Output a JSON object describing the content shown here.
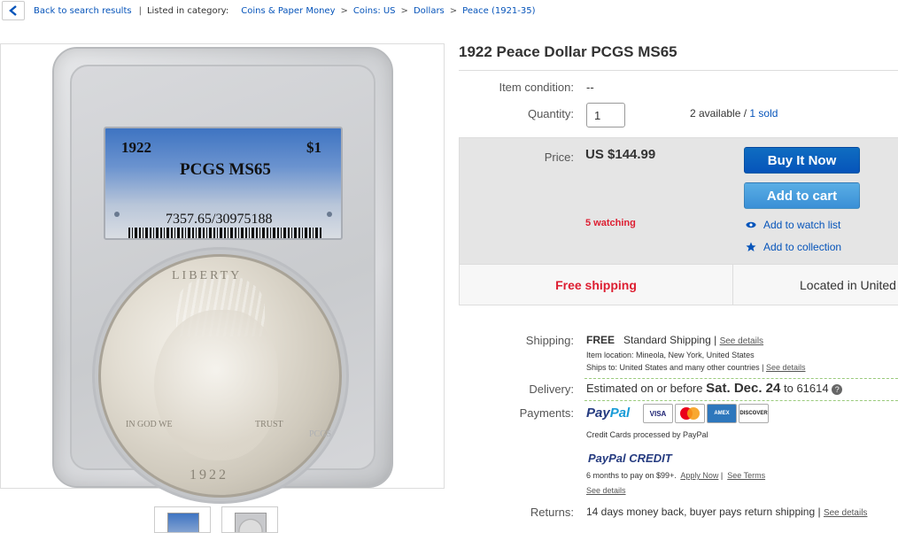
{
  "breadcrumb": {
    "back_label": "Back to search results",
    "separator": "|",
    "listed_label": "Listed in category:",
    "path": [
      "Coins & Paper Money",
      "Coins: US",
      "Dollars",
      "Peace (1921-35)"
    ],
    "path_sep": ">"
  },
  "image": {
    "label_year": "1922",
    "label_denom": "$1",
    "label_grade": "PCGS MS65",
    "label_cert": "7357.65/30975188",
    "coin_text_top": "LIBERTY",
    "coin_text_left": "IN GOD WE",
    "coin_text_right": "TRUST",
    "coin_year": "1922",
    "slab_mark": "PCGS"
  },
  "item": {
    "title": "1922 Peace Dollar PCGS MS65",
    "condition_label": "Item condition:",
    "condition_value": "--",
    "quantity_label": "Quantity:",
    "quantity_value": "1",
    "available_text": "2 available",
    "available_sep": " / ",
    "sold_text": "1 sold"
  },
  "purchase": {
    "price_label": "Price:",
    "price_value": "US $144.99",
    "watching": "5 watching",
    "buy_now": "Buy It Now",
    "add_to_cart": "Add to cart",
    "watch_list": "Add to watch list",
    "collection": "Add to collection"
  },
  "ship_bar": {
    "free": "Free shipping",
    "located": "Located in United"
  },
  "details": {
    "shipping_label": "Shipping:",
    "shipping_free": "FREE",
    "shipping_type": "Standard Shipping |",
    "see_details": "See details",
    "item_location": "Item location:  Mineola, New York, United States",
    "ships_to": "Ships to:  United States and many other countries |",
    "delivery_label": "Delivery:",
    "delivery_prefix": "Estimated on or before",
    "delivery_date": "Sat. Dec. 24",
    "delivery_suffix": "to 61614",
    "payments_label": "Payments:",
    "paypal_pay": "Pay",
    "paypal_pal": "Pal",
    "cards": [
      "VISA",
      "MC",
      "AMEX",
      "DISCOVER"
    ],
    "credit_processed": "Credit Cards processed by PayPal",
    "pp_credit_pay": "PayPal",
    "pp_credit_word": "CREDIT",
    "months": "6 months to pay on $99+.",
    "apply_now": "Apply Now",
    "see_terms": "See Terms",
    "pp_see_details": "See details",
    "returns_label": "Returns:",
    "returns_text": "14 days money back, buyer pays return shipping |",
    "returns_see": "See details"
  },
  "colors": {
    "link": "#0654ba",
    "alert_red": "#dd1e31",
    "buy_blue": "#0654ba",
    "cart_blue": "#3a8fd6",
    "price_box": "#e5e5e5"
  }
}
